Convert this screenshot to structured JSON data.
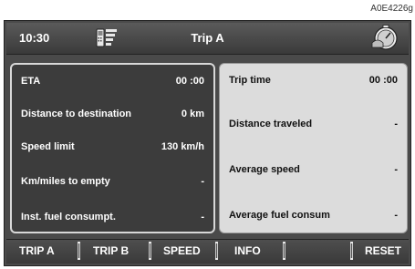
{
  "figure_code": "A0E4226g",
  "header": {
    "time": "10:30",
    "title": "Trip A",
    "phone_icon": "phone-signal-icon",
    "trip_icon": "trip-computer-icon"
  },
  "left_panel": [
    {
      "label": "ETA",
      "value": "00 :00"
    },
    {
      "label": "Distance to destination",
      "value": "0 km"
    },
    {
      "label": "Speed limit",
      "value": "130 km/h"
    },
    {
      "label": "Km/miles to empty",
      "value": "-"
    },
    {
      "label": "Inst. fuel consumpt.",
      "value": "-"
    }
  ],
  "right_panel": [
    {
      "label": "Trip time",
      "value": "00 :00"
    },
    {
      "label": "Distance traveled",
      "value": "-"
    },
    {
      "label": "Average speed",
      "value": "-"
    },
    {
      "label": "Average fuel consum",
      "value": "-"
    }
  ],
  "footer": {
    "buttons": [
      "TRIP A",
      "TRIP B",
      "SPEED",
      "INFO",
      "RESET"
    ]
  }
}
